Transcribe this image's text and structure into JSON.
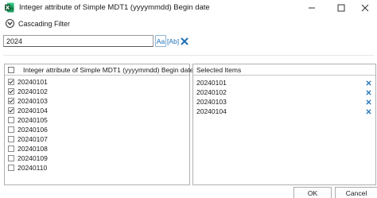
{
  "window": {
    "title": "Integer attribute of Simple MDT1 (yyyymmdd) Begin date",
    "app_icon": "excel-icon",
    "controls": [
      "minimize-icon",
      "maximize-icon",
      "close-icon"
    ]
  },
  "filter": {
    "label": "Cascading Filter",
    "icon": "chevron-down-icon"
  },
  "search": {
    "value": "2024",
    "match_case_label": "Aa",
    "whole_word_label": "[Ab]",
    "clear_icon": "close-icon"
  },
  "available": {
    "header": "Integer attribute of Simple MDT1 (yyyymmdd) Begin date",
    "items": [
      {
        "label": "20240101",
        "checked": true
      },
      {
        "label": "20240102",
        "checked": true
      },
      {
        "label": "20240103",
        "checked": true
      },
      {
        "label": "20240104",
        "checked": true
      },
      {
        "label": "20240105",
        "checked": false
      },
      {
        "label": "20240106",
        "checked": false
      },
      {
        "label": "20240107",
        "checked": false
      },
      {
        "label": "20240108",
        "checked": false
      },
      {
        "label": "20240109",
        "checked": false
      },
      {
        "label": "20240110",
        "checked": false
      }
    ]
  },
  "selected": {
    "header": "Selected Items",
    "items": [
      "20240101",
      "20240102",
      "20240103",
      "20240104"
    ]
  },
  "footer": {
    "ok_label": "OK",
    "cancel_label": "Cancel"
  },
  "colors": {
    "accent": "#1f6fb5",
    "excel_green": "#1d7044"
  }
}
